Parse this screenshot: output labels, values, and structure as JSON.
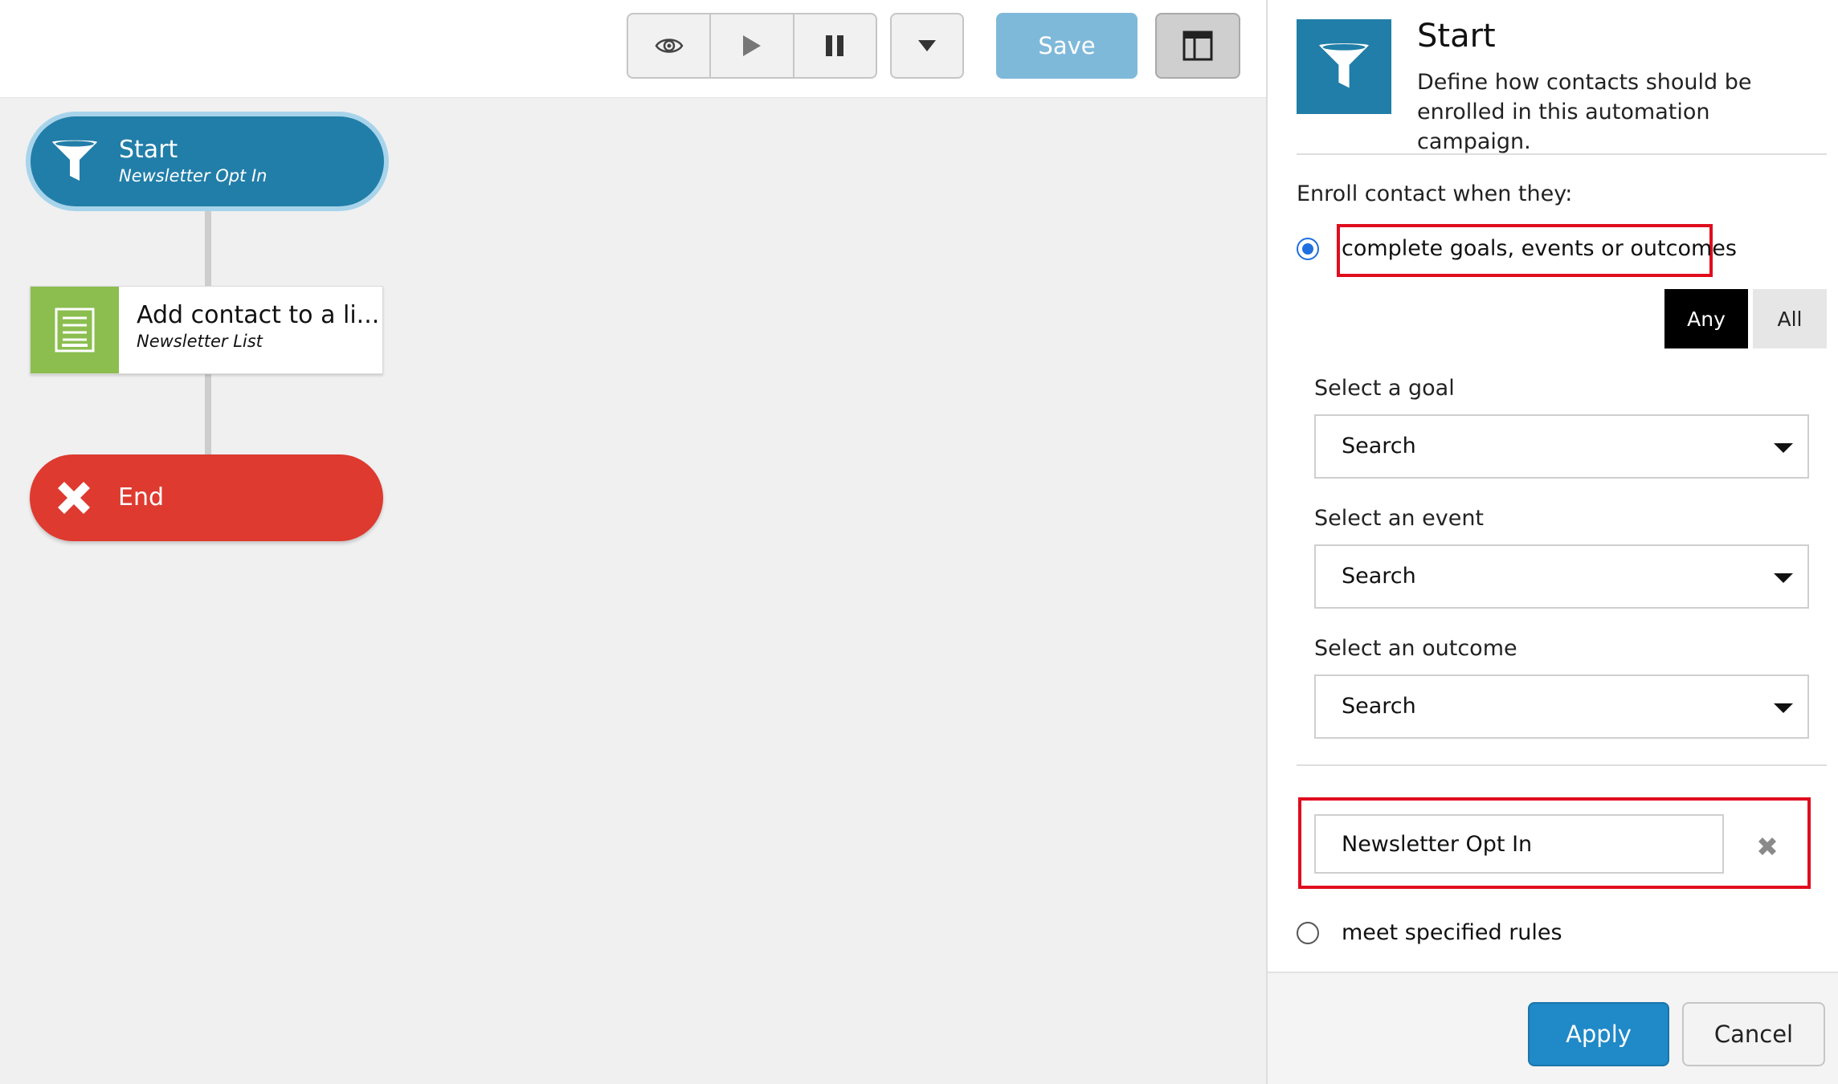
{
  "toolbar": {
    "preview_icon": "eye-icon",
    "play_icon": "play-icon",
    "pause_icon": "pause-icon",
    "dropdown_icon": "caret-down-icon",
    "save_label": "Save",
    "layout_icon": "panel-layout-icon"
  },
  "workflow": {
    "start": {
      "title": "Start",
      "subtitle": "Newsletter Opt In",
      "icon": "funnel-icon"
    },
    "action": {
      "title": "Add contact to a li...",
      "subtitle": "Newsletter List",
      "icon": "list-icon"
    },
    "end": {
      "title": "End",
      "icon": "x-icon"
    }
  },
  "panel": {
    "title": "Start",
    "description": "Define how contacts should be enrolled in this automation campaign.",
    "enroll_label": "Enroll contact when they:",
    "option_goals": "complete goals, events or outcomes",
    "option_rules": "meet specified rules",
    "match_any": "Any",
    "match_all": "All",
    "goal_label": "Select a goal",
    "goal_value": "Search",
    "event_label": "Select an event",
    "event_value": "Search",
    "outcome_label": "Select an outcome",
    "outcome_value": "Search",
    "selected_tag": "Newsletter Opt In",
    "apply_label": "Apply",
    "cancel_label": "Cancel"
  },
  "colors": {
    "start_node": "#217ea8",
    "action_icon_bg": "#8bbe4f",
    "end_node": "#de3a2f",
    "apply_button": "#2089c7",
    "highlight": "#e00d1e"
  }
}
